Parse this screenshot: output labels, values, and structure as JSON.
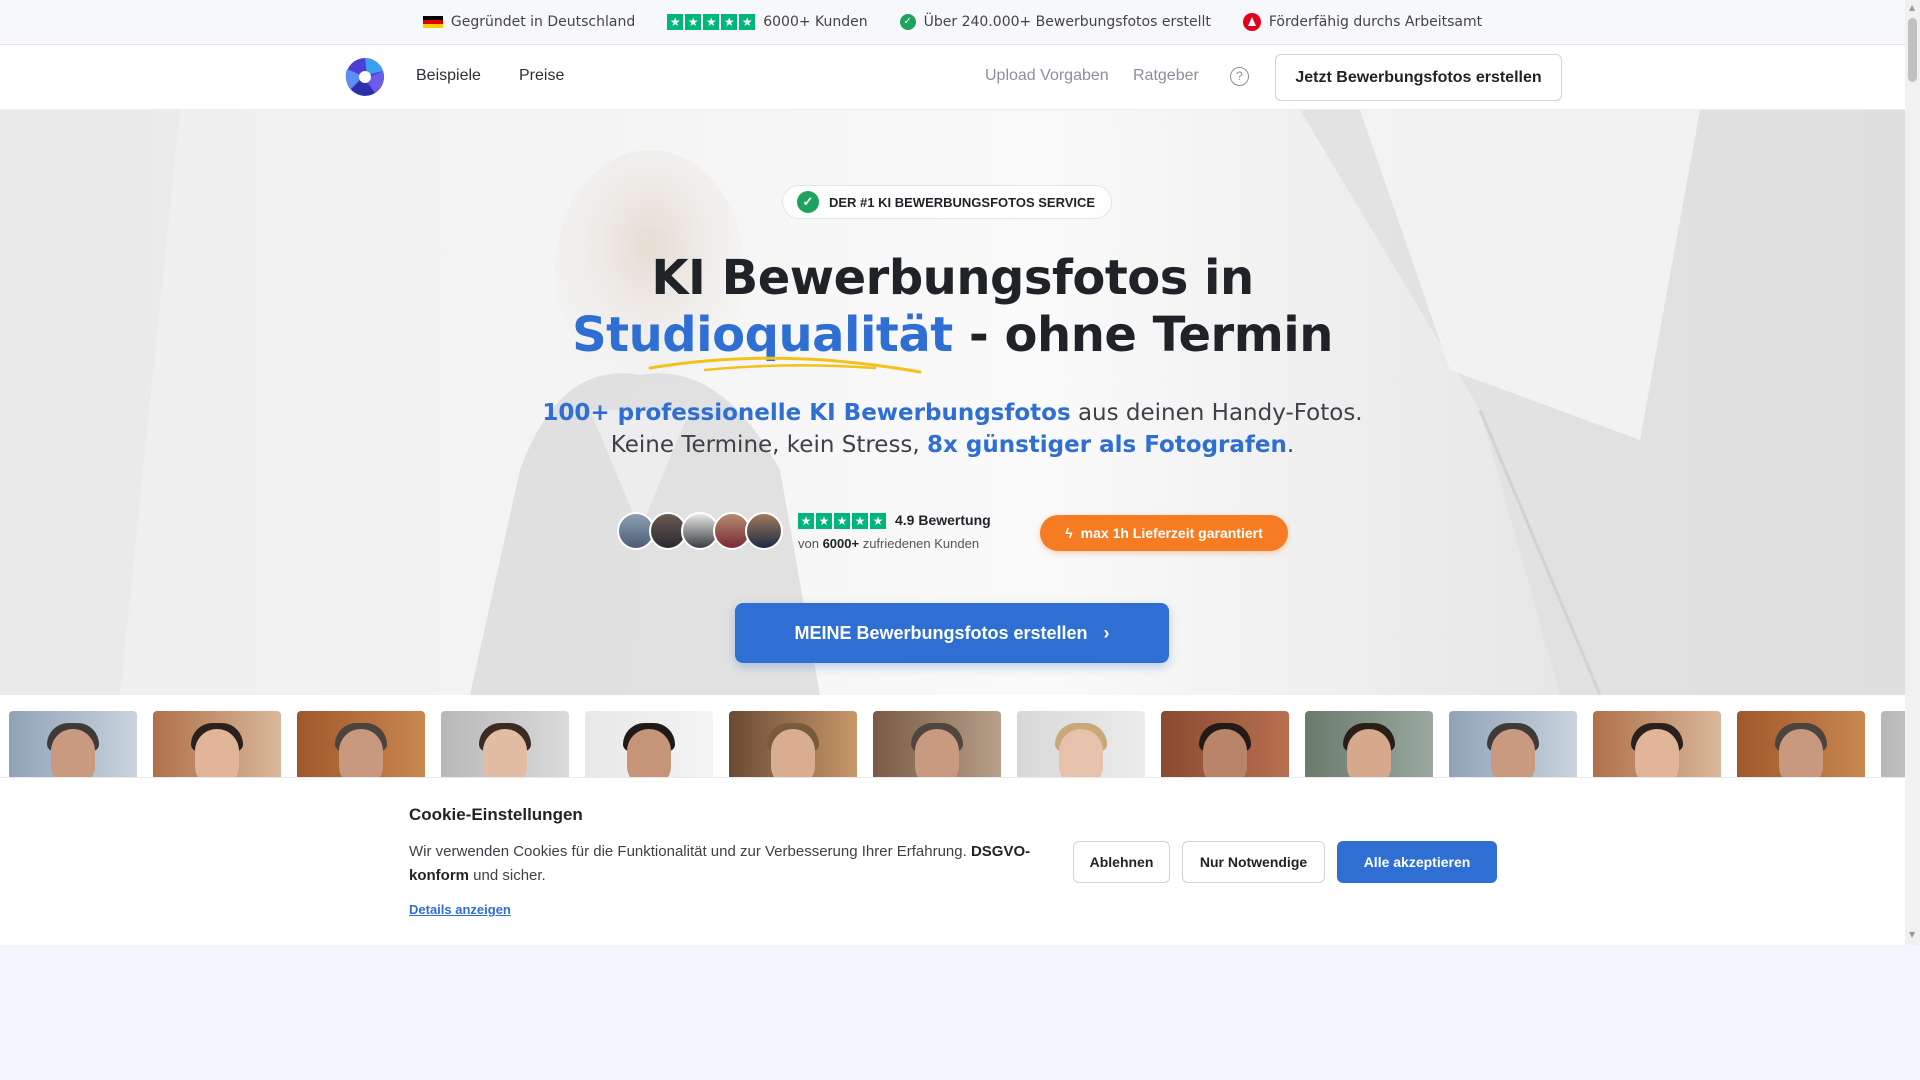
{
  "topbar": {
    "items": [
      {
        "icon": "germany-flag-icon",
        "label": "Gegründet in Deutschland"
      },
      {
        "icon": "trustpilot-stars-icon",
        "label": "6000+ Kunden"
      },
      {
        "icon": "check-badge-icon",
        "label": "Über 240.000+ Bewerbungsfotos erstellt"
      },
      {
        "icon": "arbeitsagentur-icon",
        "label": "Förderfähig durchs Arbeitsamt"
      }
    ]
  },
  "nav": {
    "links": [
      "Beispiele",
      "Preise"
    ],
    "right_links": [
      "Upload Vorgaben",
      "Ratgeber"
    ],
    "help_icon": "?",
    "cta": "Jetzt Bewerbungsfotos erstellen"
  },
  "hero": {
    "badge": "DER #1 KI BEWERBUNGSFOTOS SERVICE",
    "title_line1": "KI Bewerbungsfotos in",
    "title_highlight": "Studioqualität",
    "title_rest": " - ohne Termin",
    "sub1_bold": "100+ professionelle KI Bewerbungsfotos",
    "sub1_rest": " aus deinen Handy-Fotos.",
    "sub2_start": "Keine Termine, kein Stress, ",
    "sub2_bold": "8x günstiger als Fotografen",
    "sub2_end": ".",
    "rating_value": "4.9 Bewertung",
    "rating_prefix": "von ",
    "rating_count": "6000+",
    "rating_suffix": " zufriedenen Kunden",
    "stars": 5,
    "delivery_pill": "max 1h Lieferzeit garantiert",
    "cta": "MEINE Bewerbungsfotos erstellen"
  },
  "cookie": {
    "title": "Cookie-Einstellungen",
    "text_start": "Wir verwenden Cookies für die Funktionalität und zur Verbesserung Ihrer Erfahrung. ",
    "text_bold": "DSGVO-konform",
    "text_end": " und sicher.",
    "details": "Details anzeigen",
    "reject": "Ablehnen",
    "necessary": "Nur Notwendige",
    "accept": "Alle akzeptieren"
  },
  "colors": {
    "primary_blue": "#2f6fd3",
    "orange": "#f57c22",
    "trustpilot_green": "#00b67a",
    "check_green": "#1fa35c"
  }
}
